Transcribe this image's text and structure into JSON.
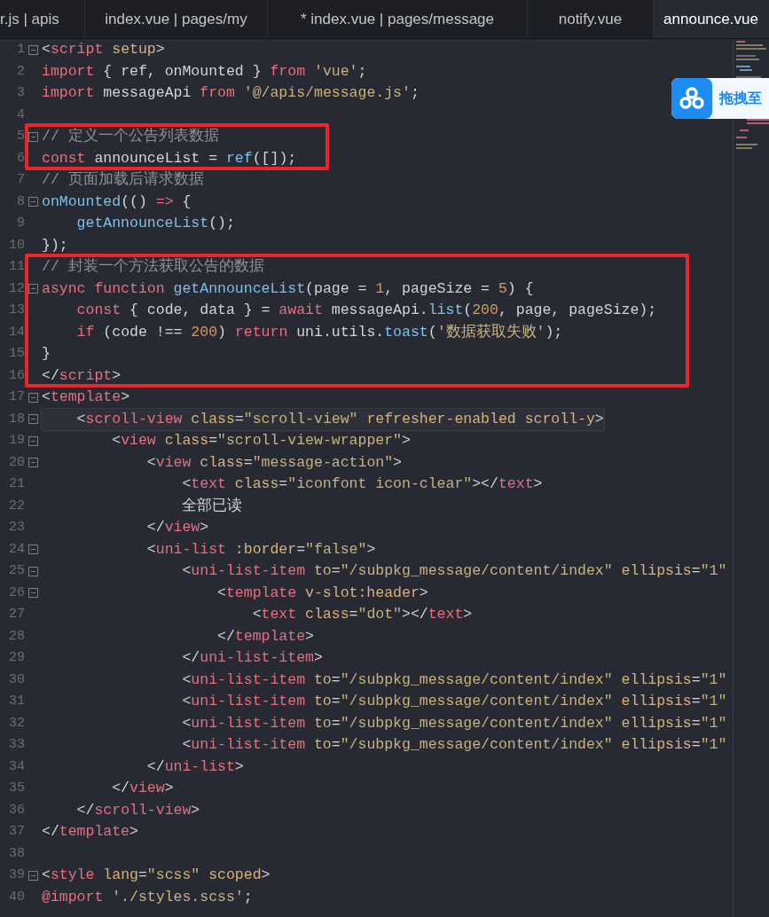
{
  "tabs": [
    {
      "label": "r.js | apis",
      "selected": false
    },
    {
      "label": "index.vue | pages/my",
      "selected": false
    },
    {
      "label": "* index.vue | pages/message",
      "selected": false
    },
    {
      "label": "notify.vue",
      "selected": false
    },
    {
      "label": "announce.vue",
      "selected": true
    }
  ],
  "segments": [
    {
      "boxed": false,
      "lines": [
        {
          "number": "1",
          "fold": true,
          "current": false,
          "tokens": [
            {
              "kind": "txt",
              "text": "<"
            },
            {
              "kind": "tag",
              "text": "script"
            },
            {
              "kind": "attr",
              "text": " setup"
            },
            {
              "kind": "txt",
              "text": ">"
            }
          ]
        },
        {
          "number": "2",
          "fold": false,
          "current": false,
          "tokens": [
            {
              "kind": "kw",
              "text": "import"
            },
            {
              "kind": "txt",
              "text": " { ref, onMounted } "
            },
            {
              "kind": "kw",
              "text": "from"
            },
            {
              "kind": "str",
              "text": " 'vue'"
            },
            {
              "kind": "txt",
              "text": ";"
            }
          ]
        },
        {
          "number": "3",
          "fold": false,
          "current": false,
          "tokens": [
            {
              "kind": "kw",
              "text": "import"
            },
            {
              "kind": "txt",
              "text": " messageApi "
            },
            {
              "kind": "kw",
              "text": "from"
            },
            {
              "kind": "str",
              "text": " '@/apis/message.js'"
            },
            {
              "kind": "txt",
              "text": ";"
            }
          ]
        },
        {
          "number": "4",
          "fold": false,
          "current": false
        }
      ]
    },
    {
      "boxed": true,
      "lines": [
        {
          "number": "5",
          "fold": true,
          "current": false,
          "tokens": [
            {
              "kind": "cmt",
              "text": "// 定义一个公告列表数据"
            }
          ]
        },
        {
          "number": "6",
          "fold": false,
          "current": false,
          "tokens": [
            {
              "kind": "kw",
              "text": "const"
            },
            {
              "kind": "txt",
              "text": " announceList = "
            },
            {
              "kind": "fn",
              "text": "ref"
            },
            {
              "kind": "txt",
              "text": "([]);"
            }
          ]
        }
      ]
    },
    {
      "boxed": false,
      "lines": [
        {
          "number": "7",
          "fold": false,
          "current": false,
          "tokens": [
            {
              "kind": "cmt",
              "text": "// 页面加载后请求数据"
            }
          ]
        },
        {
          "number": "8",
          "fold": true,
          "current": false,
          "tokens": [
            {
              "kind": "fn",
              "text": "onMounted"
            },
            {
              "kind": "txt",
              "text": "(() "
            },
            {
              "kind": "kw",
              "text": "=>"
            },
            {
              "kind": "txt",
              "text": " {"
            }
          ]
        },
        {
          "number": "9",
          "fold": false,
          "current": false,
          "tokens": [
            {
              "kind": "fn",
              "text": "    getAnnounceList"
            },
            {
              "kind": "txt",
              "text": "();"
            }
          ]
        },
        {
          "number": "10",
          "fold": false,
          "current": false,
          "tokens": [
            {
              "kind": "txt",
              "text": "});"
            }
          ]
        }
      ]
    },
    {
      "boxed": true,
      "lines": [
        {
          "number": "11",
          "fold": false,
          "current": false,
          "tokens": [
            {
              "kind": "cmt",
              "text": "// 封装一个方法获取公告的数据"
            }
          ]
        },
        {
          "number": "12",
          "fold": true,
          "current": false,
          "tokens": [
            {
              "kind": "kw",
              "text": "async"
            },
            {
              "kind": "kw",
              "text": " function"
            },
            {
              "kind": "fn",
              "text": " getAnnounceList"
            },
            {
              "kind": "txt",
              "text": "(page = "
            },
            {
              "kind": "num",
              "text": "1"
            },
            {
              "kind": "txt",
              "text": ", pageSize = "
            },
            {
              "kind": "num",
              "text": "5"
            },
            {
              "kind": "txt",
              "text": ") {"
            }
          ]
        },
        {
          "number": "13",
          "fold": false,
          "current": false,
          "tokens": [
            {
              "kind": "kw",
              "text": "    const"
            },
            {
              "kind": "txt",
              "text": " { code, data } = "
            },
            {
              "kind": "kw",
              "text": "await"
            },
            {
              "kind": "txt",
              "text": " messageApi."
            },
            {
              "kind": "fn",
              "text": "list"
            },
            {
              "kind": "txt",
              "text": "("
            },
            {
              "kind": "num",
              "text": "200"
            },
            {
              "kind": "txt",
              "text": ", page, pageSize);"
            }
          ]
        },
        {
          "number": "14",
          "fold": false,
          "current": false,
          "tokens": [
            {
              "kind": "kw",
              "text": "    if"
            },
            {
              "kind": "txt",
              "text": " (code !== "
            },
            {
              "kind": "num",
              "text": "200"
            },
            {
              "kind": "txt",
              "text": ") "
            },
            {
              "kind": "kw",
              "text": "return"
            },
            {
              "kind": "txt",
              "text": " uni.utils."
            },
            {
              "kind": "fn",
              "text": "toast"
            },
            {
              "kind": "txt",
              "text": "("
            },
            {
              "kind": "str",
              "text": "'数据获取失败'"
            },
            {
              "kind": "txt",
              "text": ");"
            }
          ]
        },
        {
          "number": "15",
          "fold": false,
          "current": false,
          "tokens": [
            {
              "kind": "txt",
              "text": "}"
            }
          ]
        },
        {
          "number": "16",
          "fold": false,
          "current": false,
          "tokens": [
            {
              "kind": "txt",
              "text": "</"
            },
            {
              "kind": "tag",
              "text": "script"
            },
            {
              "kind": "txt",
              "text": ">"
            }
          ]
        }
      ]
    },
    {
      "boxed": false,
      "lines": [
        {
          "number": "17",
          "fold": true,
          "current": false,
          "tokens": [
            {
              "kind": "txt",
              "text": "<"
            },
            {
              "kind": "tag",
              "text": "template"
            },
            {
              "kind": "txt",
              "text": ">"
            }
          ]
        },
        {
          "number": "18",
          "fold": true,
          "current": true,
          "tokens": [
            {
              "kind": "txt",
              "text": "    <"
            },
            {
              "kind": "tag",
              "text": "scroll-view"
            },
            {
              "kind": "attr",
              "text": " class"
            },
            {
              "kind": "txt",
              "text": "="
            },
            {
              "kind": "str",
              "text": "\"scroll-view\""
            },
            {
              "kind": "attr",
              "text": " refresher-enabled scroll-y"
            },
            {
              "kind": "txt",
              "text": ">"
            }
          ]
        },
        {
          "number": "19",
          "fold": true,
          "current": false,
          "tokens": [
            {
              "kind": "txt",
              "text": "        <"
            },
            {
              "kind": "tag",
              "text": "view"
            },
            {
              "kind": "attr",
              "text": " class"
            },
            {
              "kind": "txt",
              "text": "="
            },
            {
              "kind": "str",
              "text": "\"scroll-view-wrapper\""
            },
            {
              "kind": "txt",
              "text": ">"
            }
          ]
        },
        {
          "number": "20",
          "fold": true,
          "current": false,
          "tokens": [
            {
              "kind": "txt",
              "text": "            <"
            },
            {
              "kind": "tag",
              "text": "view"
            },
            {
              "kind": "attr",
              "text": " class"
            },
            {
              "kind": "txt",
              "text": "="
            },
            {
              "kind": "str",
              "text": "\"message-action\""
            },
            {
              "kind": "txt",
              "text": ">"
            }
          ]
        },
        {
          "number": "21",
          "fold": false,
          "current": false,
          "tokens": [
            {
              "kind": "txt",
              "text": "                <"
            },
            {
              "kind": "tag",
              "text": "text"
            },
            {
              "kind": "attr",
              "text": " class"
            },
            {
              "kind": "txt",
              "text": "="
            },
            {
              "kind": "str",
              "text": "\"iconfont icon-clear\""
            },
            {
              "kind": "txt",
              "text": "></"
            },
            {
              "kind": "tag",
              "text": "text"
            },
            {
              "kind": "txt",
              "text": ">"
            }
          ]
        },
        {
          "number": "22",
          "fold": false,
          "current": false,
          "tokens": [
            {
              "kind": "txt",
              "text": "                全部已读"
            }
          ]
        },
        {
          "number": "23",
          "fold": false,
          "current": false,
          "tokens": [
            {
              "kind": "txt",
              "text": "            </"
            },
            {
              "kind": "tag",
              "text": "view"
            },
            {
              "kind": "txt",
              "text": ">"
            }
          ]
        },
        {
          "number": "24",
          "fold": true,
          "current": false,
          "tokens": [
            {
              "kind": "txt",
              "text": "            <"
            },
            {
              "kind": "tag",
              "text": "uni-list"
            },
            {
              "kind": "attr",
              "text": " :border"
            },
            {
              "kind": "txt",
              "text": "="
            },
            {
              "kind": "str",
              "text": "\"false\""
            },
            {
              "kind": "txt",
              "text": ">"
            }
          ]
        },
        {
          "number": "25",
          "fold": true,
          "current": false,
          "tokens": [
            {
              "kind": "txt",
              "text": "                <"
            },
            {
              "kind": "tag",
              "text": "uni-list-item"
            },
            {
              "kind": "attr",
              "text": " to"
            },
            {
              "kind": "txt",
              "text": "="
            },
            {
              "kind": "str",
              "text": "\"/subpkg_message/content/index\""
            },
            {
              "kind": "attr",
              "text": " ellipsis"
            },
            {
              "kind": "txt",
              "text": "="
            },
            {
              "kind": "str",
              "text": "\"1\""
            }
          ]
        },
        {
          "number": "26",
          "fold": true,
          "current": false,
          "tokens": [
            {
              "kind": "txt",
              "text": "                    <"
            },
            {
              "kind": "tag",
              "text": "template"
            },
            {
              "kind": "attr",
              "text": " v-slot:header"
            },
            {
              "kind": "txt",
              "text": ">"
            }
          ]
        },
        {
          "number": "27",
          "fold": false,
          "current": false,
          "tokens": [
            {
              "kind": "txt",
              "text": "                        <"
            },
            {
              "kind": "tag",
              "text": "text"
            },
            {
              "kind": "attr",
              "text": " class"
            },
            {
              "kind": "txt",
              "text": "="
            },
            {
              "kind": "str",
              "text": "\"dot\""
            },
            {
              "kind": "txt",
              "text": "></"
            },
            {
              "kind": "tag",
              "text": "text"
            },
            {
              "kind": "txt",
              "text": ">"
            }
          ]
        },
        {
          "number": "28",
          "fold": false,
          "current": false,
          "tokens": [
            {
              "kind": "txt",
              "text": "                    </"
            },
            {
              "kind": "tag",
              "text": "template"
            },
            {
              "kind": "txt",
              "text": ">"
            }
          ]
        },
        {
          "number": "29",
          "fold": false,
          "current": false,
          "tokens": [
            {
              "kind": "txt",
              "text": "                </"
            },
            {
              "kind": "tag",
              "text": "uni-list-item"
            },
            {
              "kind": "txt",
              "text": ">"
            }
          ]
        },
        {
          "number": "30",
          "fold": false,
          "current": false,
          "tokens": [
            {
              "kind": "txt",
              "text": "                <"
            },
            {
              "kind": "tag",
              "text": "uni-list-item"
            },
            {
              "kind": "attr",
              "text": " to"
            },
            {
              "kind": "txt",
              "text": "="
            },
            {
              "kind": "str",
              "text": "\"/subpkg_message/content/index\""
            },
            {
              "kind": "attr",
              "text": " ellipsis"
            },
            {
              "kind": "txt",
              "text": "="
            },
            {
              "kind": "str",
              "text": "\"1\""
            }
          ]
        },
        {
          "number": "31",
          "fold": false,
          "current": false,
          "tokens": [
            {
              "kind": "txt",
              "text": "                <"
            },
            {
              "kind": "tag",
              "text": "uni-list-item"
            },
            {
              "kind": "attr",
              "text": " to"
            },
            {
              "kind": "txt",
              "text": "="
            },
            {
              "kind": "str",
              "text": "\"/subpkg_message/content/index\""
            },
            {
              "kind": "attr",
              "text": " ellipsis"
            },
            {
              "kind": "txt",
              "text": "="
            },
            {
              "kind": "str",
              "text": "\"1\""
            }
          ]
        },
        {
          "number": "32",
          "fold": false,
          "current": false,
          "tokens": [
            {
              "kind": "txt",
              "text": "                <"
            },
            {
              "kind": "tag",
              "text": "uni-list-item"
            },
            {
              "kind": "attr",
              "text": " to"
            },
            {
              "kind": "txt",
              "text": "="
            },
            {
              "kind": "str",
              "text": "\"/subpkg_message/content/index\""
            },
            {
              "kind": "attr",
              "text": " ellipsis"
            },
            {
              "kind": "txt",
              "text": "="
            },
            {
              "kind": "str",
              "text": "\"1\""
            }
          ]
        },
        {
          "number": "33",
          "fold": false,
          "current": false,
          "tokens": [
            {
              "kind": "txt",
              "text": "                <"
            },
            {
              "kind": "tag",
              "text": "uni-list-item"
            },
            {
              "kind": "attr",
              "text": " to"
            },
            {
              "kind": "txt",
              "text": "="
            },
            {
              "kind": "str",
              "text": "\"/subpkg_message/content/index\""
            },
            {
              "kind": "attr",
              "text": " ellipsis"
            },
            {
              "kind": "txt",
              "text": "="
            },
            {
              "kind": "str",
              "text": "\"1\""
            }
          ]
        },
        {
          "number": "34",
          "fold": false,
          "current": false,
          "tokens": [
            {
              "kind": "txt",
              "text": "            </"
            },
            {
              "kind": "tag",
              "text": "uni-list"
            },
            {
              "kind": "txt",
              "text": ">"
            }
          ]
        },
        {
          "number": "35",
          "fold": false,
          "current": false,
          "tokens": [
            {
              "kind": "txt",
              "text": "        </"
            },
            {
              "kind": "tag",
              "text": "view"
            },
            {
              "kind": "txt",
              "text": ">"
            }
          ]
        },
        {
          "number": "36",
          "fold": false,
          "current": false,
          "tokens": [
            {
              "kind": "txt",
              "text": "    </"
            },
            {
              "kind": "tag",
              "text": "scroll-view"
            },
            {
              "kind": "txt",
              "text": ">"
            }
          ]
        },
        {
          "number": "37",
          "fold": false,
          "current": false,
          "tokens": [
            {
              "kind": "txt",
              "text": "</"
            },
            {
              "kind": "tag",
              "text": "template"
            },
            {
              "kind": "txt",
              "text": ">"
            }
          ]
        },
        {
          "number": "38",
          "fold": false,
          "current": false
        },
        {
          "number": "39",
          "fold": true,
          "current": false,
          "tokens": [
            {
              "kind": "txt",
              "text": "<"
            },
            {
              "kind": "tag",
              "text": "style"
            },
            {
              "kind": "attr",
              "text": " lang"
            },
            {
              "kind": "txt",
              "text": "="
            },
            {
              "kind": "str",
              "text": "\"scss\""
            },
            {
              "kind": "attr",
              "text": " scoped"
            },
            {
              "kind": "txt",
              "text": ">"
            }
          ]
        },
        {
          "number": "40",
          "fold": false,
          "current": false,
          "tokens": [
            {
              "kind": "kw",
              "text": "@import"
            },
            {
              "kind": "str",
              "text": " './styles.scss'"
            },
            {
              "kind": "txt",
              "text": ";"
            }
          ]
        }
      ]
    }
  ],
  "drop_panel": {
    "label": "拖拽至"
  }
}
